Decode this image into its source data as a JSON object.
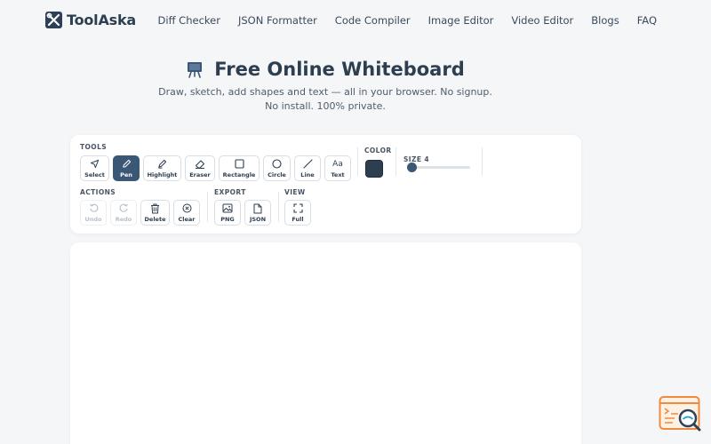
{
  "brand": {
    "name": "ToolAska"
  },
  "nav": [
    "Diff Checker",
    "JSON Formatter",
    "Code Compiler",
    "Image Editor",
    "Video Editor",
    "Blogs",
    "FAQ"
  ],
  "hero": {
    "title": "Free Online Whiteboard",
    "subtitle_line1": "Draw, sketch, add shapes and text — all in your browser. No signup.",
    "subtitle_line2": "No install. 100% private."
  },
  "toolbar": {
    "tools_label": "TOOLS",
    "tools": [
      {
        "label": "Select",
        "icon": "cursor-icon"
      },
      {
        "label": "Pen",
        "icon": "pen-icon",
        "active": true
      },
      {
        "label": "Highlight",
        "icon": "highlighter-icon"
      },
      {
        "label": "Eraser",
        "icon": "eraser-icon"
      },
      {
        "label": "Rectangle",
        "icon": "square-icon"
      },
      {
        "label": "Circle",
        "icon": "circle-icon"
      },
      {
        "label": "Line",
        "icon": "line-icon"
      },
      {
        "label": "Text",
        "icon": "text-icon",
        "glyph": "Aa"
      }
    ],
    "color_label": "COLOR",
    "color_value": "#2c3e50",
    "size_label": "SIZE 4",
    "size_value": 4,
    "actions_label": "ACTIONS",
    "actions": [
      {
        "label": "Undo",
        "icon": "undo-icon",
        "disabled": true
      },
      {
        "label": "Redo",
        "icon": "redo-icon",
        "disabled": true
      },
      {
        "label": "Delete",
        "icon": "trash-icon"
      },
      {
        "label": "Clear",
        "icon": "clear-circle-icon"
      }
    ],
    "export_label": "EXPORT",
    "export": [
      {
        "label": "PNG",
        "icon": "image-icon"
      },
      {
        "label": "JSON",
        "icon": "file-icon"
      }
    ],
    "view_label": "VIEW",
    "view": [
      {
        "label": "Full",
        "icon": "fullscreen-icon"
      }
    ]
  },
  "colors": {
    "accent": "#3a5775",
    "text": "#2c3e50",
    "widget": "#f08a3c"
  }
}
